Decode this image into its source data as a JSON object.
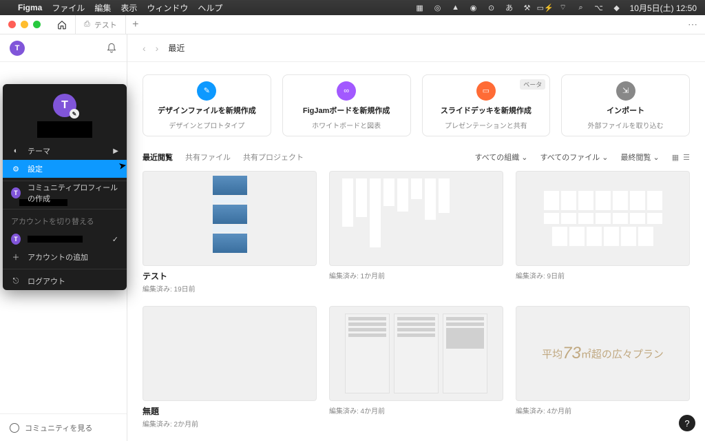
{
  "menubar": {
    "app": "Figma",
    "items": [
      "ファイル",
      "編集",
      "表示",
      "ウィンドウ",
      "ヘルプ"
    ],
    "datetime": "10月5日(土)  12:50"
  },
  "tabs": {
    "extra": "テスト"
  },
  "sidebar": {
    "avatar": "T",
    "community": "コミュニティを見る"
  },
  "menu": {
    "avatar": "T",
    "theme": "テーマ",
    "settings": "設定",
    "community_profile": "コミュニティプロフィールの作成",
    "switch_account": "アカウントを切り替える",
    "add_account": "アカウントの追加",
    "logout": "ログアウト"
  },
  "breadcrumb": "最近",
  "cards": [
    {
      "title": "デザインファイルを新規作成",
      "sub": "デザインとプロトタイプ"
    },
    {
      "title": "FigJamボードを新規作成",
      "sub": "ホワイトボードと図表"
    },
    {
      "title": "スライドデッキを新規作成",
      "sub": "プレゼンテーションと共有",
      "beta": "ベータ"
    },
    {
      "title": "インポート",
      "sub": "外部ファイルを取り込む"
    }
  ],
  "filter": {
    "tabs": [
      "最近閲覧",
      "共有ファイル",
      "共有プロジェクト"
    ],
    "dd": [
      "すべての組織",
      "すべてのファイル",
      "最終閲覧"
    ]
  },
  "projects": [
    {
      "name": "テスト",
      "meta": "編集済み: 19日前"
    },
    {
      "name": "",
      "meta": "編集済み: 1か月前"
    },
    {
      "name": "",
      "meta": "編集済み: 9日前"
    },
    {
      "name": "無題",
      "meta": "編集済み: 2か月前"
    },
    {
      "name": "",
      "meta": "編集済み: 4か月前"
    },
    {
      "name": "",
      "meta": "編集済み: 4か月前"
    }
  ],
  "dark_text": {
    "pre": "平均",
    "num": "73",
    "post": "㎡超の広々プラン"
  }
}
